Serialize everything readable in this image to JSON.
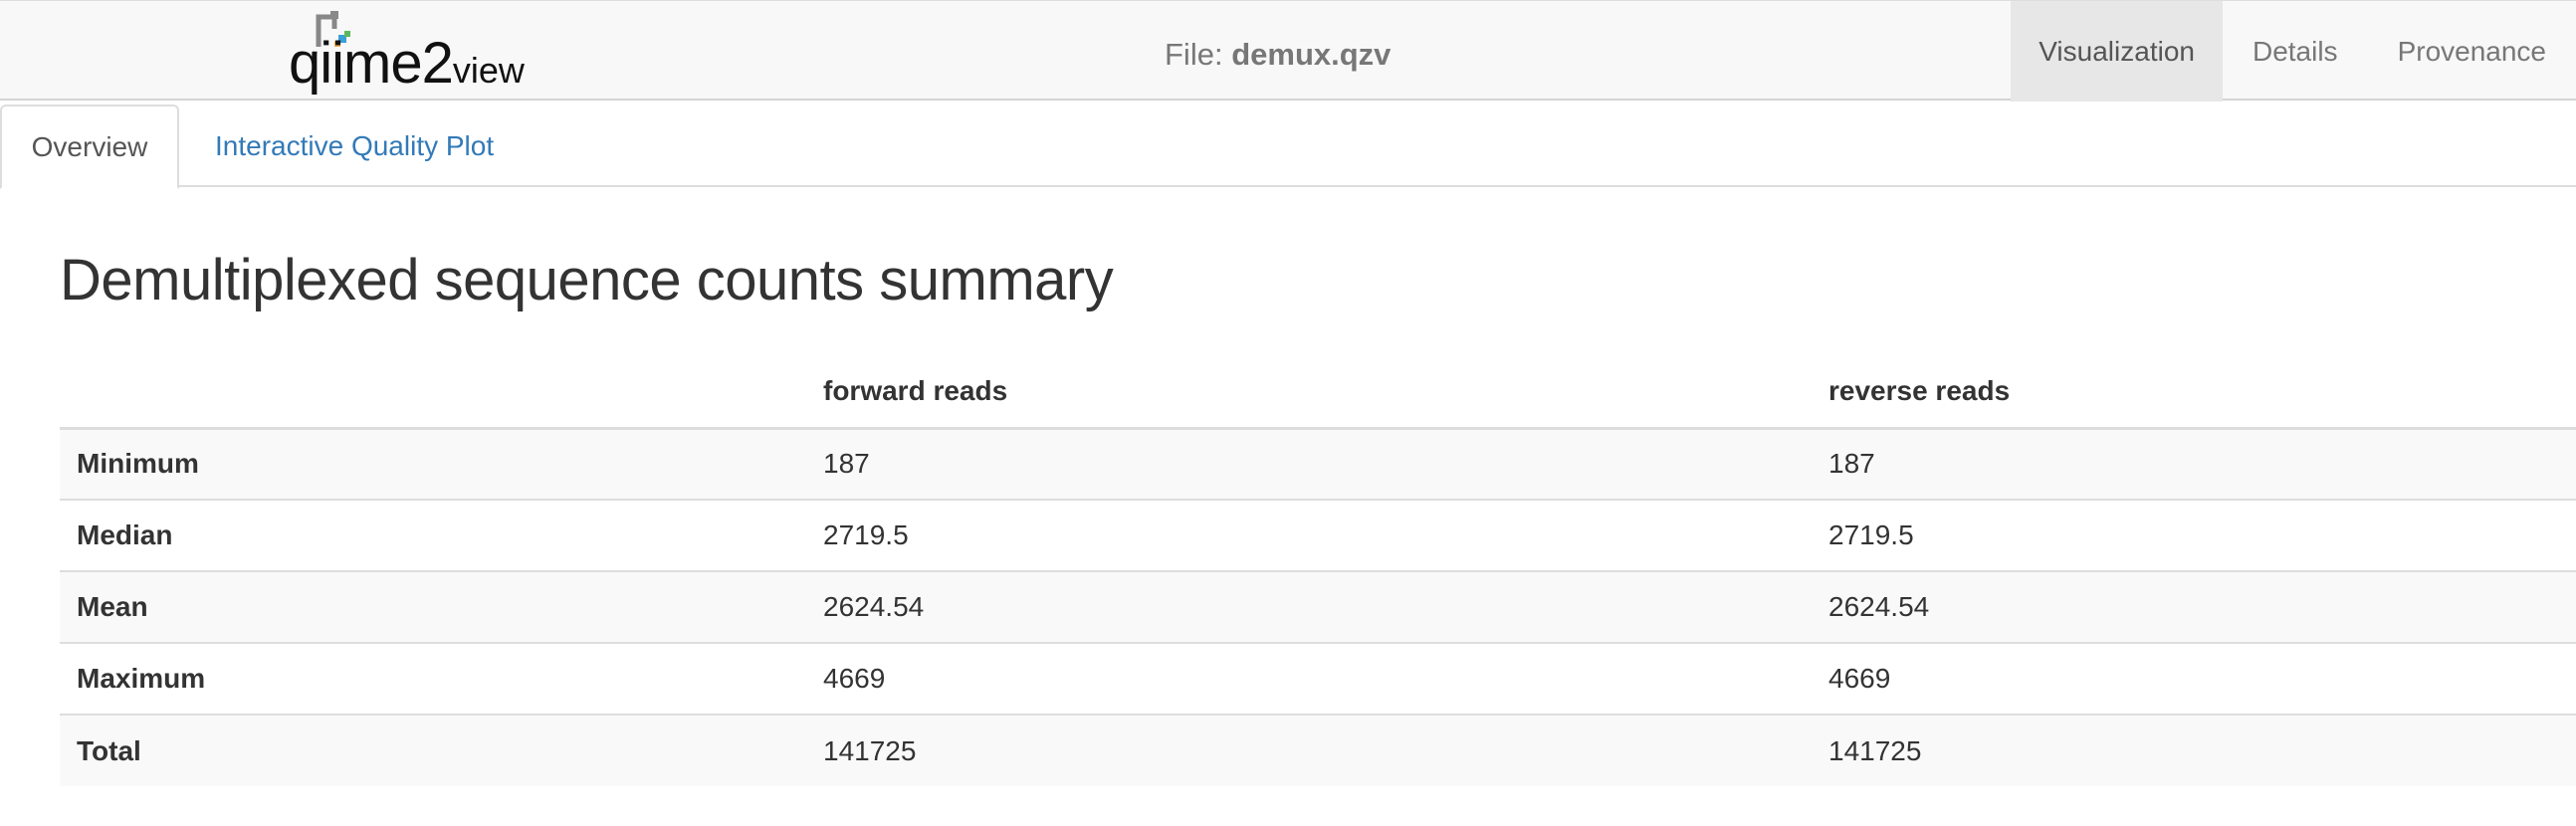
{
  "navbar": {
    "logo": {
      "prefix": "qiime2",
      "suffix": "view"
    },
    "file_label": "File:",
    "file_name": "demux.qzv",
    "tabs": [
      {
        "label": "Visualization",
        "active": true
      },
      {
        "label": "Details",
        "active": false
      },
      {
        "label": "Provenance",
        "active": false
      }
    ]
  },
  "subtabs": [
    {
      "label": "Overview",
      "active": true
    },
    {
      "label": "Interactive Quality Plot",
      "active": false
    }
  ],
  "main": {
    "title": "Demultiplexed sequence counts summary",
    "table": {
      "columns": [
        "",
        "forward reads",
        "reverse reads"
      ],
      "rows": [
        {
          "label": "Minimum",
          "forward": "187",
          "reverse": "187"
        },
        {
          "label": "Median",
          "forward": "2719.5",
          "reverse": "2719.5"
        },
        {
          "label": "Mean",
          "forward": "2624.54",
          "reverse": "2624.54"
        },
        {
          "label": "Maximum",
          "forward": "4669",
          "reverse": "4669"
        },
        {
          "label": "Total",
          "forward": "141725",
          "reverse": "141725"
        }
      ]
    }
  },
  "colors": {
    "link": "#337ab7",
    "navbar_bg": "#f8f8f8",
    "active_tab_bg": "#e7e7e7"
  }
}
